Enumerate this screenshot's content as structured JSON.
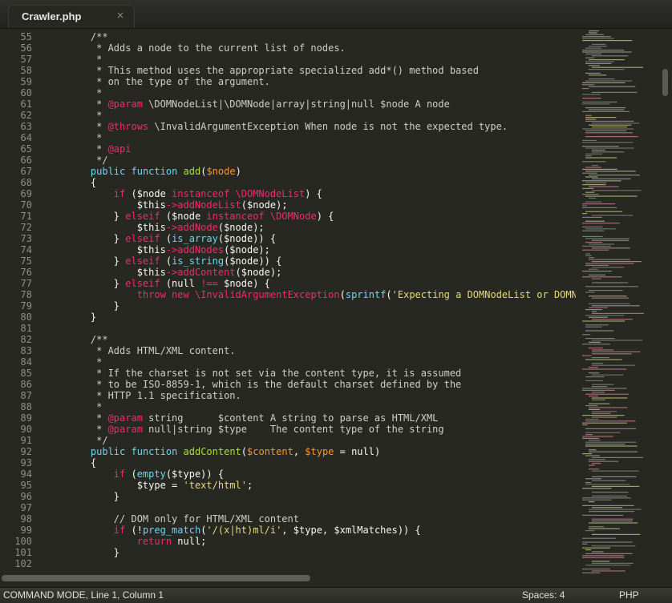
{
  "tab": {
    "title": "Crawler.php",
    "close_glyph": "×"
  },
  "status": {
    "mode": "COMMAND MODE, Line 1, Column 1",
    "indentation": "Spaces: 4",
    "syntax": "PHP"
  },
  "theme": {
    "background": "#272822",
    "comment": "#cfcfc2",
    "keyword": "#f92672",
    "string": "#e6db74",
    "function": "#a6e22e",
    "support": "#66d9ef",
    "variable": "#fd971f"
  },
  "code_lines": [
    {
      "n": "55",
      "t": [
        [
          "c",
          "    /**"
        ]
      ]
    },
    {
      "n": "56",
      "t": [
        [
          "c",
          "     * Adds a node to the current list of nodes."
        ]
      ]
    },
    {
      "n": "57",
      "t": [
        [
          "c",
          "     *"
        ]
      ]
    },
    {
      "n": "58",
      "t": [
        [
          "c",
          "     * This method uses the appropriate specialized add*() method based"
        ]
      ]
    },
    {
      "n": "59",
      "t": [
        [
          "c",
          "     * on the type of the argument."
        ]
      ]
    },
    {
      "n": "60",
      "t": [
        [
          "c",
          "     *"
        ]
      ]
    },
    {
      "n": "61",
      "t": [
        [
          "c",
          "     * "
        ],
        [
          "k",
          "@param"
        ],
        [
          "c",
          " \\DOMNodeList|\\DOMNode|array|string|null $node A node"
        ]
      ]
    },
    {
      "n": "62",
      "t": [
        [
          "c",
          "     *"
        ]
      ]
    },
    {
      "n": "63",
      "t": [
        [
          "c",
          "     * "
        ],
        [
          "k",
          "@throws"
        ],
        [
          "c",
          " \\InvalidArgumentException When node is not the expected type."
        ]
      ]
    },
    {
      "n": "64",
      "t": [
        [
          "c",
          "     *"
        ]
      ]
    },
    {
      "n": "65",
      "t": [
        [
          "c",
          "     * "
        ],
        [
          "k",
          "@api"
        ]
      ]
    },
    {
      "n": "66",
      "t": [
        [
          "c",
          "     */"
        ]
      ]
    },
    {
      "n": "67",
      "t": [
        [
          "p",
          "    "
        ],
        [
          "n",
          "public"
        ],
        [
          "p",
          " "
        ],
        [
          "n",
          "function"
        ],
        [
          "p",
          " "
        ],
        [
          "f",
          "add"
        ],
        [
          "p",
          "("
        ],
        [
          "v",
          "$node"
        ],
        [
          "p",
          ")"
        ]
      ]
    },
    {
      "n": "68",
      "t": [
        [
          "p",
          "    {"
        ]
      ]
    },
    {
      "n": "69",
      "t": [
        [
          "p",
          "        "
        ],
        [
          "k",
          "if"
        ],
        [
          "p",
          " ($node "
        ],
        [
          "k",
          "instanceof"
        ],
        [
          "p",
          " "
        ],
        [
          "k",
          "\\DOMNodeList"
        ],
        [
          "p",
          ") {"
        ]
      ]
    },
    {
      "n": "70",
      "t": [
        [
          "p",
          "            $this"
        ],
        [
          "k",
          "->"
        ],
        [
          "k",
          "addNodeList"
        ],
        [
          "p",
          "($node);"
        ]
      ]
    },
    {
      "n": "71",
      "t": [
        [
          "p",
          "        } "
        ],
        [
          "k",
          "elseif"
        ],
        [
          "p",
          " ($node "
        ],
        [
          "k",
          "instanceof"
        ],
        [
          "p",
          " "
        ],
        [
          "k",
          "\\DOMNode"
        ],
        [
          "p",
          ") {"
        ]
      ]
    },
    {
      "n": "72",
      "t": [
        [
          "p",
          "            $this"
        ],
        [
          "k",
          "->"
        ],
        [
          "k",
          "addNode"
        ],
        [
          "p",
          "($node);"
        ]
      ]
    },
    {
      "n": "73",
      "t": [
        [
          "p",
          "        } "
        ],
        [
          "k",
          "elseif"
        ],
        [
          "p",
          " ("
        ],
        [
          "n",
          "is_array"
        ],
        [
          "p",
          "($node)) {"
        ]
      ]
    },
    {
      "n": "74",
      "t": [
        [
          "p",
          "            $this"
        ],
        [
          "k",
          "->"
        ],
        [
          "k",
          "addNodes"
        ],
        [
          "p",
          "($node);"
        ]
      ]
    },
    {
      "n": "75",
      "t": [
        [
          "p",
          "        } "
        ],
        [
          "k",
          "elseif"
        ],
        [
          "p",
          " ("
        ],
        [
          "n",
          "is_string"
        ],
        [
          "p",
          "($node)) {"
        ]
      ]
    },
    {
      "n": "76",
      "t": [
        [
          "p",
          "            $this"
        ],
        [
          "k",
          "->"
        ],
        [
          "k",
          "addContent"
        ],
        [
          "p",
          "($node);"
        ]
      ]
    },
    {
      "n": "77",
      "t": [
        [
          "p",
          "        } "
        ],
        [
          "k",
          "elseif"
        ],
        [
          "p",
          " (null "
        ],
        [
          "k",
          "!=="
        ],
        [
          "p",
          " $node) {"
        ]
      ]
    },
    {
      "n": "78",
      "t": [
        [
          "p",
          "            "
        ],
        [
          "k",
          "throw"
        ],
        [
          "p",
          " "
        ],
        [
          "k",
          "new"
        ],
        [
          "p",
          " "
        ],
        [
          "k",
          "\\InvalidArgumentException"
        ],
        [
          "p",
          "("
        ],
        [
          "n",
          "sprintf"
        ],
        [
          "p",
          "("
        ],
        [
          "s",
          "'Expecting a DOMNodeList or DOMNode inst"
        ]
      ]
    },
    {
      "n": "79",
      "t": [
        [
          "p",
          "        }"
        ]
      ]
    },
    {
      "n": "80",
      "t": [
        [
          "p",
          "    }"
        ]
      ]
    },
    {
      "n": "81",
      "t": [
        [
          "p",
          ""
        ]
      ]
    },
    {
      "n": "82",
      "t": [
        [
          "c",
          "    /**"
        ]
      ]
    },
    {
      "n": "83",
      "t": [
        [
          "c",
          "     * Adds HTML/XML content."
        ]
      ]
    },
    {
      "n": "84",
      "t": [
        [
          "c",
          "     *"
        ]
      ]
    },
    {
      "n": "85",
      "t": [
        [
          "c",
          "     * If the charset is not set via the content type, it is assumed"
        ]
      ]
    },
    {
      "n": "86",
      "t": [
        [
          "c",
          "     * to be ISO-8859-1, which is the default charset defined by the"
        ]
      ]
    },
    {
      "n": "87",
      "t": [
        [
          "c",
          "     * HTTP 1.1 specification."
        ]
      ]
    },
    {
      "n": "88",
      "t": [
        [
          "c",
          "     *"
        ]
      ]
    },
    {
      "n": "89",
      "t": [
        [
          "c",
          "     * "
        ],
        [
          "k",
          "@param"
        ],
        [
          "c",
          " string      $content A string to parse as HTML/XML"
        ]
      ]
    },
    {
      "n": "90",
      "t": [
        [
          "c",
          "     * "
        ],
        [
          "k",
          "@param"
        ],
        [
          "c",
          " null|string $type    The content type of the string"
        ]
      ]
    },
    {
      "n": "91",
      "t": [
        [
          "c",
          "     */"
        ]
      ]
    },
    {
      "n": "92",
      "t": [
        [
          "p",
          "    "
        ],
        [
          "n",
          "public"
        ],
        [
          "p",
          " "
        ],
        [
          "n",
          "function"
        ],
        [
          "p",
          " "
        ],
        [
          "f",
          "addContent"
        ],
        [
          "p",
          "("
        ],
        [
          "v",
          "$content"
        ],
        [
          "p",
          ", "
        ],
        [
          "v",
          "$type"
        ],
        [
          "p",
          " = null)"
        ]
      ]
    },
    {
      "n": "93",
      "t": [
        [
          "p",
          "    {"
        ]
      ]
    },
    {
      "n": "94",
      "t": [
        [
          "p",
          "        "
        ],
        [
          "k",
          "if"
        ],
        [
          "p",
          " ("
        ],
        [
          "n",
          "empty"
        ],
        [
          "p",
          "($type)) {"
        ]
      ]
    },
    {
      "n": "95",
      "t": [
        [
          "p",
          "            $type = "
        ],
        [
          "s",
          "'text/html'"
        ],
        [
          "p",
          ";"
        ]
      ]
    },
    {
      "n": "96",
      "t": [
        [
          "p",
          "        }"
        ]
      ]
    },
    {
      "n": "97",
      "t": [
        [
          "p",
          ""
        ]
      ]
    },
    {
      "n": "98",
      "t": [
        [
          "c",
          "        // DOM only for HTML/XML content"
        ]
      ]
    },
    {
      "n": "99",
      "t": [
        [
          "p",
          "        "
        ],
        [
          "k",
          "if"
        ],
        [
          "p",
          " (!"
        ],
        [
          "n",
          "preg_match"
        ],
        [
          "p",
          "("
        ],
        [
          "s",
          "'/(x|ht)ml/i'"
        ],
        [
          "p",
          ", $type, $xmlMatches)) {"
        ]
      ]
    },
    {
      "n": "100",
      "t": [
        [
          "p",
          "            "
        ],
        [
          "k",
          "return"
        ],
        [
          "p",
          " null;"
        ]
      ]
    },
    {
      "n": "101",
      "t": [
        [
          "p",
          "        }"
        ]
      ]
    },
    {
      "n": "102",
      "t": [
        [
          "p",
          ""
        ]
      ]
    }
  ]
}
